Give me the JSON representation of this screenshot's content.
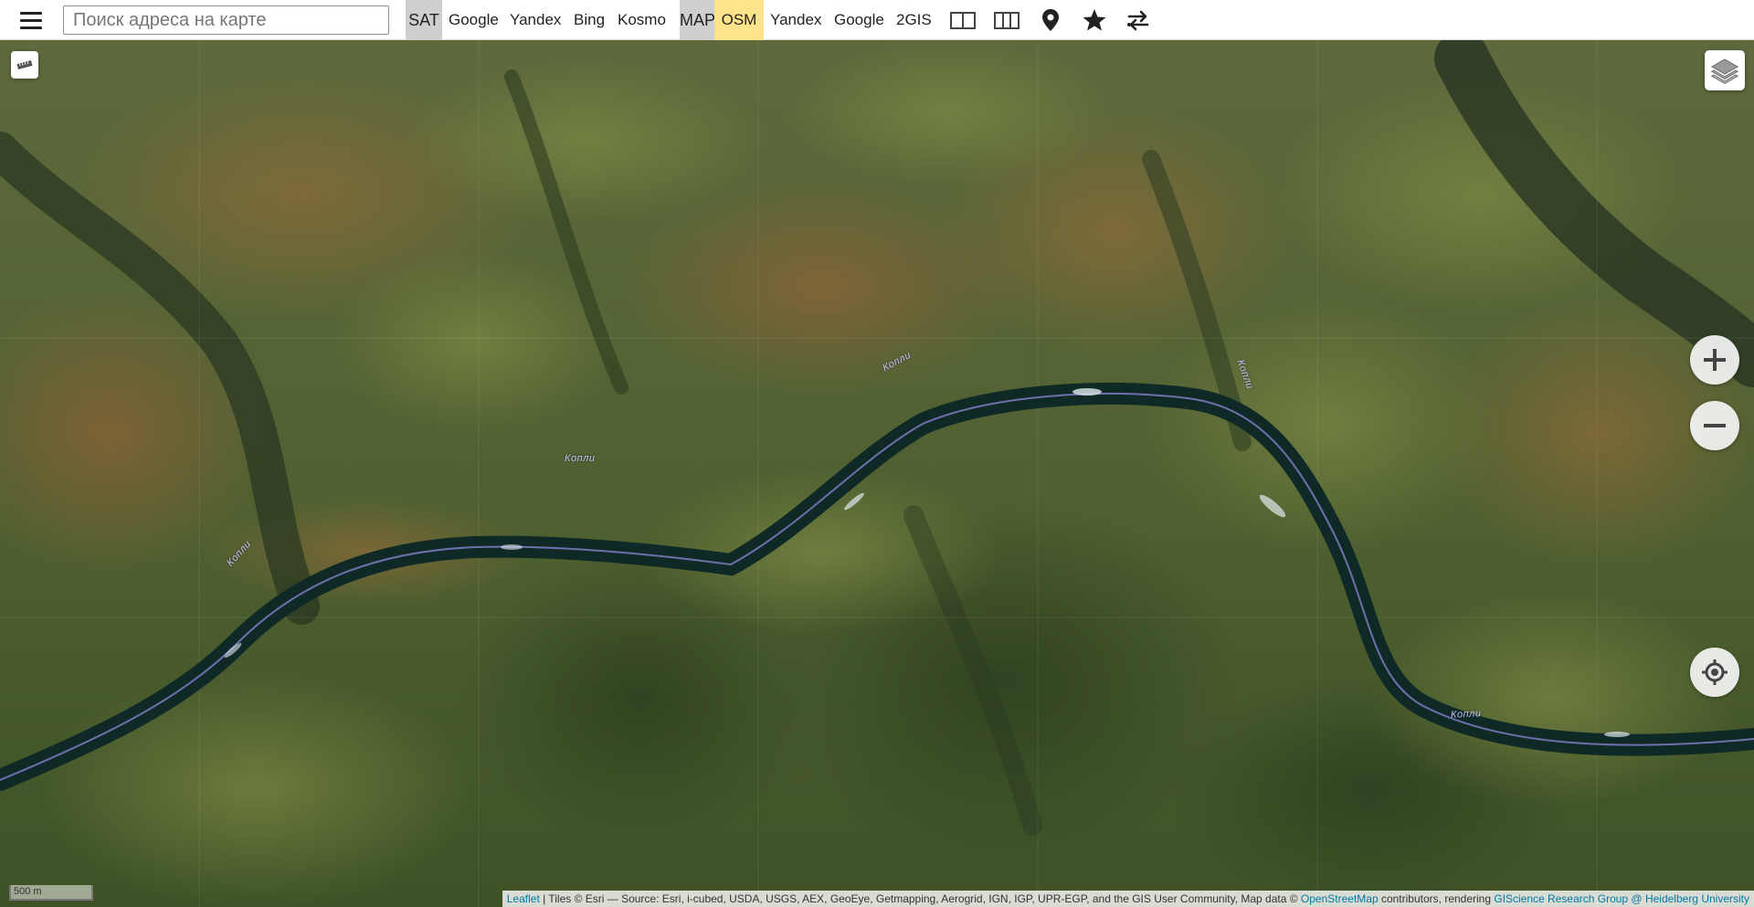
{
  "toolbar": {
    "search_placeholder": "Поиск адреса на карте",
    "sat_label": "SAT",
    "sat_providers": [
      "Google",
      "Yandex",
      "Bing",
      "Kosmo"
    ],
    "map_label": "MAP",
    "map_active": "OSM",
    "map_providers": [
      "Yandex",
      "Google",
      "2GIS"
    ]
  },
  "map": {
    "river_labels": [
      "Копли",
      "Копли",
      "Копли",
      "Копли"
    ],
    "scale_label": "500 m",
    "attribution": {
      "leaflet": "Leaflet",
      "tiles_text": " | Tiles © Esri — Source: Esri, i-cubed, USDA, USGS, AEX, GeoEye, Getmapping, Aerogrid, IGN, IGP, UPR-EGP, and the GIS User Community, Map data © ",
      "osm": "OpenStreetMap",
      "rendering_text": " contributors, rendering ",
      "giscience": "GIScience Research Group @ Heidelberg University"
    }
  },
  "colors": {
    "active_tab": "#ffe38a",
    "mode_tab": "#cfcfcf",
    "river": "#0f2a26",
    "link": "#0078a8"
  }
}
